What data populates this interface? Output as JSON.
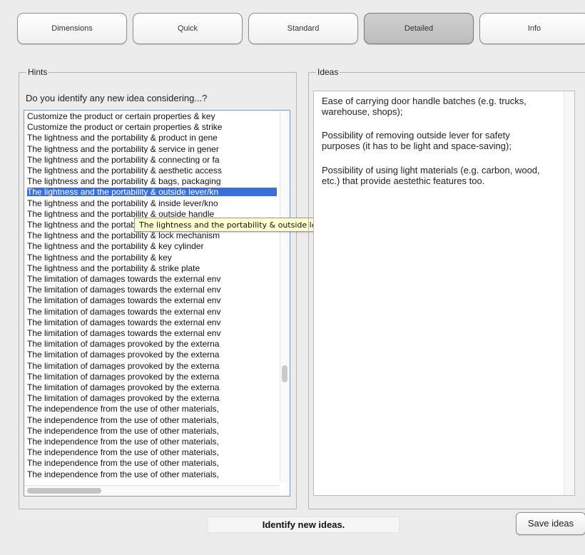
{
  "tabs": [
    {
      "label": "Dimensions",
      "active": false
    },
    {
      "label": "Quick",
      "active": false
    },
    {
      "label": "Standard",
      "active": false
    },
    {
      "label": "Detailed",
      "active": true
    },
    {
      "label": "Info",
      "active": false
    }
  ],
  "hints": {
    "legend": "Hints",
    "question": "Do you identify any new idea considering...?",
    "items": [
      "Customize the product or certain properties & key",
      "Customize the product or certain properties & strike",
      "The lightness and the portability & product in gene",
      "The lightness and the portability & service in gener",
      "The lightness and the portability & connecting or fa",
      "The lightness and the portability & aesthetic access",
      "The lightness and the portability & bags, packaging",
      "The lightness and the portability & outside lever/kn",
      "The lightness and the portability & inside lever/kno",
      "The lightness and the portability & outside handle",
      "The lightness and the portability & inside escutcheon",
      "The lightness and the portability & lock mechanism",
      "The lightness and the portability & key cylinder",
      "The lightness and the portability & key",
      "The lightness and the portability & strike plate",
      "The limitation of damages towards the external env",
      "The limitation of damages towards the external env",
      "The limitation of damages towards the external env",
      "The limitation of damages towards the external env",
      "The limitation of damages towards the external env",
      "The limitation of damages towards the external env",
      "The limitation of damages provoked by the externa",
      "The limitation of damages provoked by the externa",
      "The limitation of damages provoked by the externa",
      "The limitation of damages provoked by the externa",
      "The limitation of damages provoked by the externa",
      "The limitation of damages provoked by the externa",
      "The independence from the use of other materials,",
      "The independence from the use of other materials,",
      "The independence from the use of other materials,",
      "The independence from the use of other materials,",
      "The independence from the use of other materials,",
      "The independence from the use of other materials,",
      "The independence from the use of other materials,"
    ],
    "selected_index": 7,
    "tooltip": "The lightness and the portability & outside lever/knob",
    "scroll_position": 0.72
  },
  "ideas": {
    "legend": "Ideas",
    "entries": [
      "Ease of carrying door handle batches (e.g. trucks, warehouse, shops);",
      "Possibility of removing outside lever for safety purposes (it has to be light and space-saving);",
      "Possibility of using light materials (e.g. carbon, wood, etc.) that provide aestethic features too."
    ]
  },
  "status_text": "Identify new ideas.",
  "save_label": "Save ideas",
  "colors": {
    "selection": "#3a6fd8",
    "tooltip_bg": "#ffffcf",
    "window_bg": "#ececec"
  }
}
